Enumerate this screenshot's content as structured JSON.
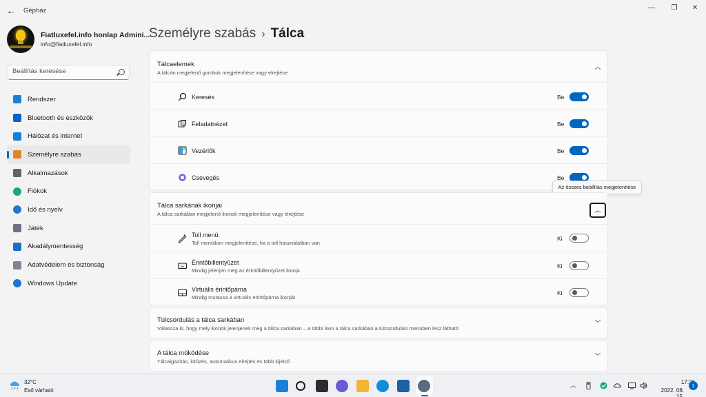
{
  "app": {
    "title": "Gépház"
  },
  "window_controls": {
    "minimize": "—",
    "restore": "❐",
    "close": "✕"
  },
  "profile": {
    "name": "Fiatluxefel.info honlap Admini...",
    "email": "info@fiatluxefel.info"
  },
  "search": {
    "placeholder": "Beállítás keresése"
  },
  "sidebar": {
    "items": [
      {
        "label": "Rendszer",
        "icon": "monitor-icon",
        "color": "#1c7fd6"
      },
      {
        "label": "Bluetooth és eszközök",
        "icon": "bluetooth-icon",
        "color": "#0a63c8"
      },
      {
        "label": "Hálózat és internet",
        "icon": "wifi-icon",
        "color": "#1480d8"
      },
      {
        "label": "Személyre szabás",
        "icon": "brush-icon",
        "color": "#e0852b",
        "active": true
      },
      {
        "label": "Alkalmazások",
        "icon": "apps-icon",
        "color": "#5c6470"
      },
      {
        "label": "Fiókok",
        "icon": "person-icon",
        "color": "#1fa37a"
      },
      {
        "label": "Idő és nyelv",
        "icon": "globe-clock-icon",
        "color": "#1a78cf"
      },
      {
        "label": "Játék",
        "icon": "gamepad-icon",
        "color": "#6b7280"
      },
      {
        "label": "Akadálymentesség",
        "icon": "accessibility-icon",
        "color": "#1a6fc6"
      },
      {
        "label": "Adatvédelem és biztonság",
        "icon": "shield-icon",
        "color": "#7d8590"
      },
      {
        "label": "Windows Update",
        "icon": "update-icon",
        "color": "#1a78cf"
      }
    ]
  },
  "header": {
    "crumb": "Személyre szabás",
    "separator": "›",
    "current": "Tálca"
  },
  "taskbar_items": {
    "title": "Tálcaelemek",
    "desc": "A tálcán megjelenő gombok megjelenítése vagy elrejtése",
    "chevron": "︿",
    "items": [
      {
        "label": "Keresés",
        "state": "Be",
        "on": true,
        "icon": "search-icon"
      },
      {
        "label": "Feladatnézet",
        "state": "Be",
        "on": true,
        "icon": "task-view-icon"
      },
      {
        "label": "Vezérlők",
        "state": "Be",
        "on": true,
        "icon": "widgets-icon"
      },
      {
        "label": "Csevegés",
        "state": "Be",
        "on": true,
        "icon": "chat-icon"
      }
    ]
  },
  "tooltip": {
    "text": "Az összes beállítás megjelenítése"
  },
  "corner_icons": {
    "title": "Tálca sarkának ikonjai",
    "desc": "A tálca sarkában megjelenő ikonok megjelenítése vagy elrejtése",
    "chevron": "︿",
    "items": [
      {
        "label": "Toll menü",
        "sub": "Toll menüikon megjelenítése, ha a toll használatban van",
        "state": "Ki",
        "on": false,
        "icon": "pen-icon"
      },
      {
        "label": "Érintőbillentyűzet",
        "sub": "Mindig jelenjen meg az érintőbillentyűzet ikonja",
        "state": "Ki",
        "on": false,
        "icon": "keyboard-icon"
      },
      {
        "label": "Virtuális érintőpárna",
        "sub": "Mindig mutassa a virtuális érintőpárna ikonját",
        "state": "Ki",
        "on": false,
        "icon": "touchpad-icon"
      }
    ]
  },
  "overflow": {
    "title": "Túlcsordulás a tálca sarkában",
    "desc": "Válassza ki, hogy mely ikonok jelenjenek meg a tálca sarkában – a többi ikon a tálca sarkában a túlcsordulási menüben lesz látható",
    "chevron": "﹀"
  },
  "behavior": {
    "title": "A tálca működése",
    "desc": "Tálcaigazítás, kitűzés, automatikus elrejtés és több kijelző",
    "chevron": "﹀"
  },
  "weather": {
    "temp": "32°C",
    "desc": "Eső várható"
  },
  "taskbar_apps": [
    {
      "name": "start-button",
      "color": "#1b7fd8"
    },
    {
      "name": "taskbar-search",
      "color": "#1b1b1b"
    },
    {
      "name": "taskbar-task-view",
      "color": "#2b2b2b"
    },
    {
      "name": "taskbar-chat",
      "color": "#6b5bd2"
    },
    {
      "name": "taskbar-file-explorer",
      "color": "#f2b632"
    },
    {
      "name": "taskbar-edge",
      "color": "#0f8fd6"
    },
    {
      "name": "taskbar-store",
      "color": "#1d5fa8"
    },
    {
      "name": "taskbar-settings",
      "color": "#5a6a80"
    }
  ],
  "tray": {
    "chevron": "︿",
    "clock_time": "17:26",
    "clock_date": "2022. 08. 15.",
    "notifications": "1"
  }
}
